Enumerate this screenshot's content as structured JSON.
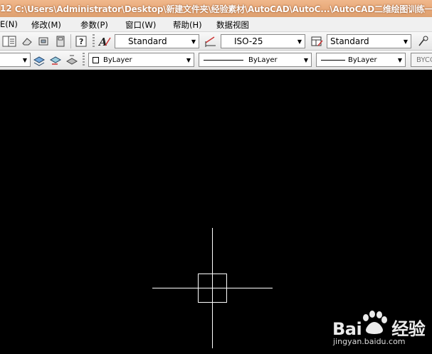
{
  "titlebar": {
    "version": "12",
    "path": "C:\\Users\\Administrator\\Desktop\\新建文件夹\\经验素材\\AutoCAD\\AutoC...\\AutoCAD二维绘图训练一.dwg"
  },
  "menu": [
    "E(N)",
    "修改(M)",
    "参数(P)",
    "窗口(W)",
    "帮助(H)",
    "数据视图"
  ],
  "toolbar1": {
    "text_style": "Standard",
    "dim_style": "ISO-25",
    "table_style": "Standard"
  },
  "toolbar2": {
    "color": "ByLayer",
    "linetype": "ByLayer",
    "lineweight": "ByLayer",
    "plotstyle": "BYCOLOR"
  },
  "watermark": {
    "brand": "Bai",
    "brand_cn": "经验",
    "url": "jingyan.baidu.com"
  },
  "colors": {
    "titlebar": "#e8a878",
    "drawing_bg": "#000000",
    "crosshair": "#ffffff"
  }
}
